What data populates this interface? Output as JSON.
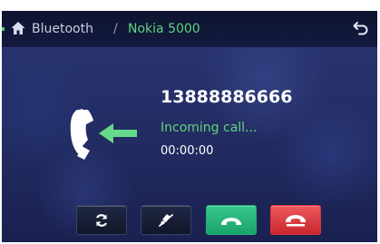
{
  "header": {
    "home_icon": "home-icon",
    "breadcrumb_section": "Bluetooth",
    "breadcrumb_separator": "/",
    "breadcrumb_device": "Nokia 5000",
    "back_icon": "back-arrow-icon"
  },
  "call": {
    "icon": "incoming-call-icon",
    "number": "13888886666",
    "status": "Incoming call...",
    "duration": "00:00:00"
  },
  "buttons": [
    {
      "name": "switch-audio-button",
      "icon": "refresh-icon"
    },
    {
      "name": "mute-button",
      "icon": "mic-mute-icon"
    },
    {
      "name": "answer-button",
      "icon": "phone-answer-icon"
    },
    {
      "name": "reject-button",
      "icon": "phone-hangup-icon"
    }
  ],
  "colors": {
    "accent_green": "#5fd37d",
    "answer_green": "#22b077",
    "reject_red": "#d6353c",
    "background_blue": "#222c62"
  }
}
